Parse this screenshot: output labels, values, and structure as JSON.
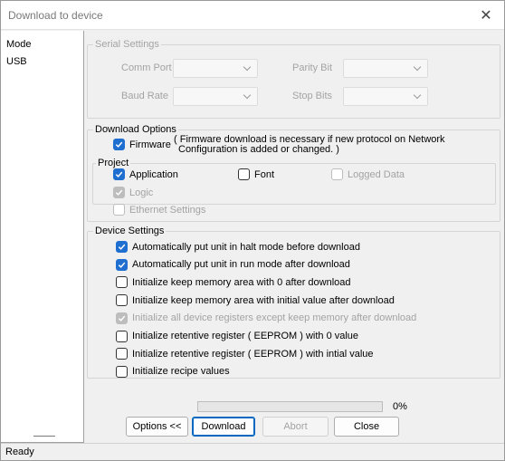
{
  "window": {
    "title": "Download to device",
    "close_label": "✕"
  },
  "sidebar": {
    "items": [
      {
        "label": "Mode"
      },
      {
        "label": "USB"
      }
    ]
  },
  "serial_settings": {
    "title": "Serial Settings",
    "comm_port_label": "Comm Port",
    "baud_rate_label": "Baud Rate",
    "parity_bit_label": "Parity Bit",
    "stop_bits_label": "Stop Bits"
  },
  "download_options": {
    "title": "Download Options",
    "firmware": {
      "label": "Firmware",
      "checked": true,
      "note_line1": "( Firmware download is necessary if new protocol on Network",
      "note_line2": "Configuration is added or changed. )"
    },
    "project": {
      "title": "Project",
      "application": {
        "label": "Application",
        "checked": true
      },
      "font": {
        "label": "Font",
        "checked": false
      },
      "logged_data": {
        "label": "Logged Data",
        "checked": false,
        "disabled": true
      },
      "logic": {
        "label": "Logic",
        "checked": true,
        "disabled": true
      }
    },
    "ethernet_settings": {
      "label": "Ethernet Settings",
      "checked": false,
      "disabled": true
    }
  },
  "device_settings": {
    "title": "Device Settings",
    "items": [
      {
        "label": "Automatically put unit in halt mode before download",
        "checked": true,
        "disabled": false
      },
      {
        "label": "Automatically put unit in run mode after download",
        "checked": true,
        "disabled": false
      },
      {
        "label": "Initialize keep memory area with 0 after download",
        "checked": false,
        "disabled": false
      },
      {
        "label": "Initialize keep memory area with initial value after download",
        "checked": false,
        "disabled": false
      },
      {
        "label": "Initialize all device registers except keep memory after download",
        "checked": true,
        "disabled": true
      },
      {
        "label": "Initialize retentive register  ( EEPROM ) with 0 value",
        "checked": false,
        "disabled": false
      },
      {
        "label": "Initialize retentive register ( EEPROM ) with intial value",
        "checked": false,
        "disabled": false
      },
      {
        "label": "Initialize recipe values",
        "checked": false,
        "disabled": false
      }
    ]
  },
  "progress": {
    "value": 0,
    "label": "0%"
  },
  "buttons": {
    "options": "Options <<",
    "download": "Download",
    "abort": "Abort",
    "close": "Close"
  },
  "status": {
    "text": "Ready"
  },
  "colors": {
    "accent": "#1f6fd1",
    "progress": "#06b025"
  }
}
